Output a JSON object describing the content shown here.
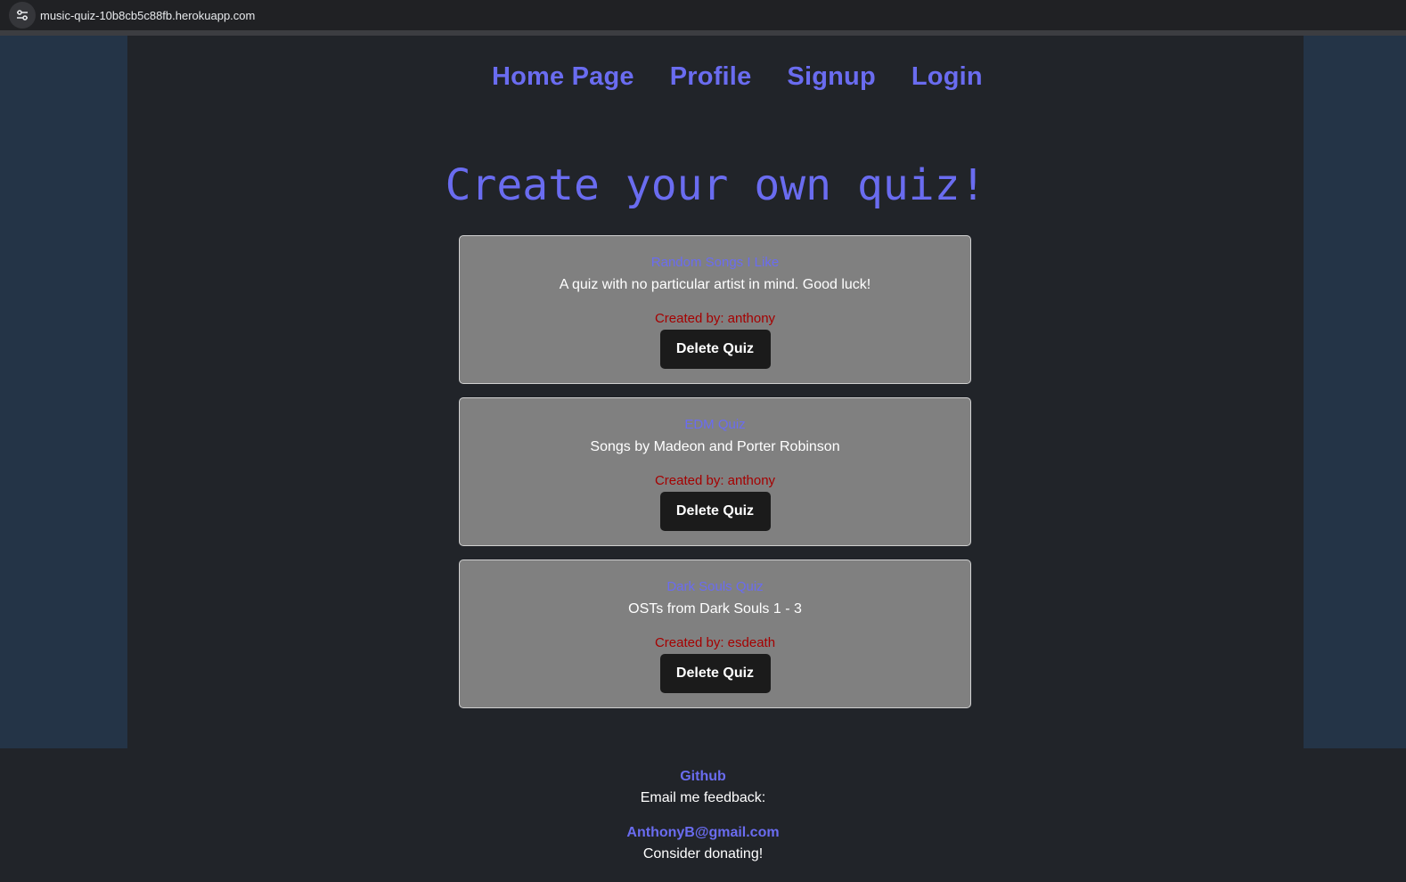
{
  "browser": {
    "url": "music-quiz-10b8cb5c88fb.herokuapp.com",
    "site_info_icon": "tune-icon"
  },
  "nav": {
    "home": "Home Page",
    "profile": "Profile",
    "signup": "Signup",
    "login": "Login"
  },
  "main": {
    "title": "Create your own quiz!",
    "quizzes": [
      {
        "title": "Random Songs I Like",
        "description": "A quiz with no particular artist in mind. Good luck!",
        "author": "Created by: anthony",
        "delete_label": "Delete Quiz"
      },
      {
        "title": "EDM Quiz",
        "description": "Songs by Madeon and Porter Robinson",
        "author": "Created by: anthony",
        "delete_label": "Delete Quiz"
      },
      {
        "title": "Dark Souls Quiz",
        "description": "OSTs from Dark Souls 1 - 3",
        "author": "Created by: esdeath",
        "delete_label": "Delete Quiz"
      }
    ]
  },
  "footer": {
    "github": "Github",
    "feedback": "Email me feedback:",
    "email": "AnthonyB@gmail.com",
    "donate": "Consider donating!"
  },
  "colors": {
    "accent": "#6a6cf0",
    "author_red": "#a50000",
    "card_bg": "#808080",
    "page_bg": "#212429",
    "side_bg": "#243447",
    "button_bg": "#1b1b1b"
  }
}
